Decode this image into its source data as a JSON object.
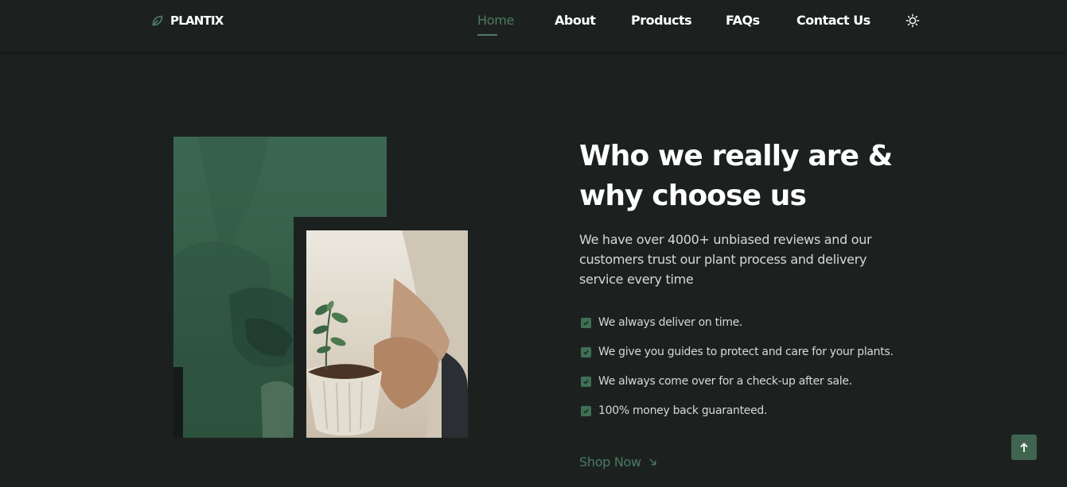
{
  "header": {
    "logo_text": "PLANTIX",
    "nav": [
      {
        "label": "Home",
        "active": true
      },
      {
        "label": "About",
        "active": false
      },
      {
        "label": "Products",
        "active": false
      },
      {
        "label": "FAQs",
        "active": false
      },
      {
        "label": "Contact Us",
        "active": false
      }
    ],
    "theme_icon": "sun-icon"
  },
  "about": {
    "heading_line1": "Who we really are &",
    "heading_line2": "why choose us",
    "description": "We have over 4000+ unbiased reviews and our customers trust our plant process and delivery service every time",
    "features": [
      "We always deliver on time.",
      "We give you guides to protect and care for your plants.",
      "We always come over for a check-up after sale.",
      "100% money back guaranteed."
    ],
    "cta_label": "Shop Now",
    "cta_icon": "arrow-down-right-icon"
  },
  "scroll_top_icon": "arrow-up-icon",
  "colors": {
    "background": "#1c2120",
    "accent": "#4c7a62",
    "check_bg": "#3f6f55",
    "text": "#ffffff",
    "muted_text": "#d6d8d7"
  }
}
